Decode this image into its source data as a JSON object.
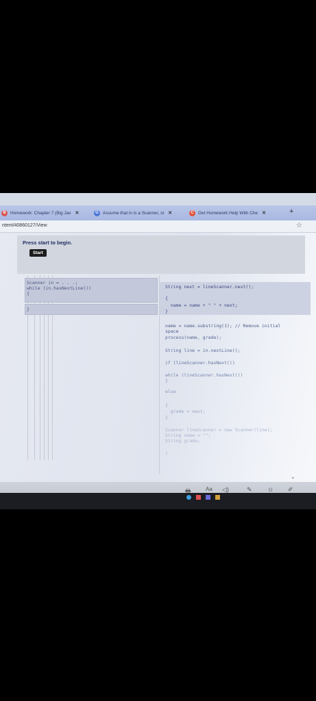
{
  "tabs": [
    {
      "icon_letter": "B",
      "icon_color": "#d9534f",
      "label": "Homework: Chapter 7 (Big Jav"
    },
    {
      "icon_letter": "G",
      "icon_color": "#4a76d6",
      "label": "Assume that in is a Scanner, st"
    },
    {
      "icon_letter": "C",
      "icon_color": "#e0533c",
      "label": "Get Homework Help With Che"
    }
  ],
  "address_bar": {
    "url": "ntent/40860127/View"
  },
  "banner": {
    "instruction": "Press start to begin.",
    "start_label": "Start"
  },
  "left_panel": {
    "box1": [
      "Scanner in = . . .;",
      "while (in.hasNextLine())",
      "{"
    ],
    "box2": [
      "}"
    ]
  },
  "right_panel": {
    "lines": [
      "String next = lineScanner.next();",
      "{",
      "  name = name + \" \" + next;",
      "}",
      "name = name.substring(1); // Remove initial",
      "space",
      "process(name, grade);",
      "String line = in.nextLine();",
      "if (lineScanner.hasNext())",
      "while (lineScanner.hasNext())",
      "}",
      "else",
      "{",
      "  grade = next;",
      "}",
      "Scanner lineScanner = new Scanner(line);",
      "String name = \"\";",
      "String grade;",
      "}"
    ]
  },
  "bottom_toolbar": {
    "text_size_label": "Aa"
  }
}
